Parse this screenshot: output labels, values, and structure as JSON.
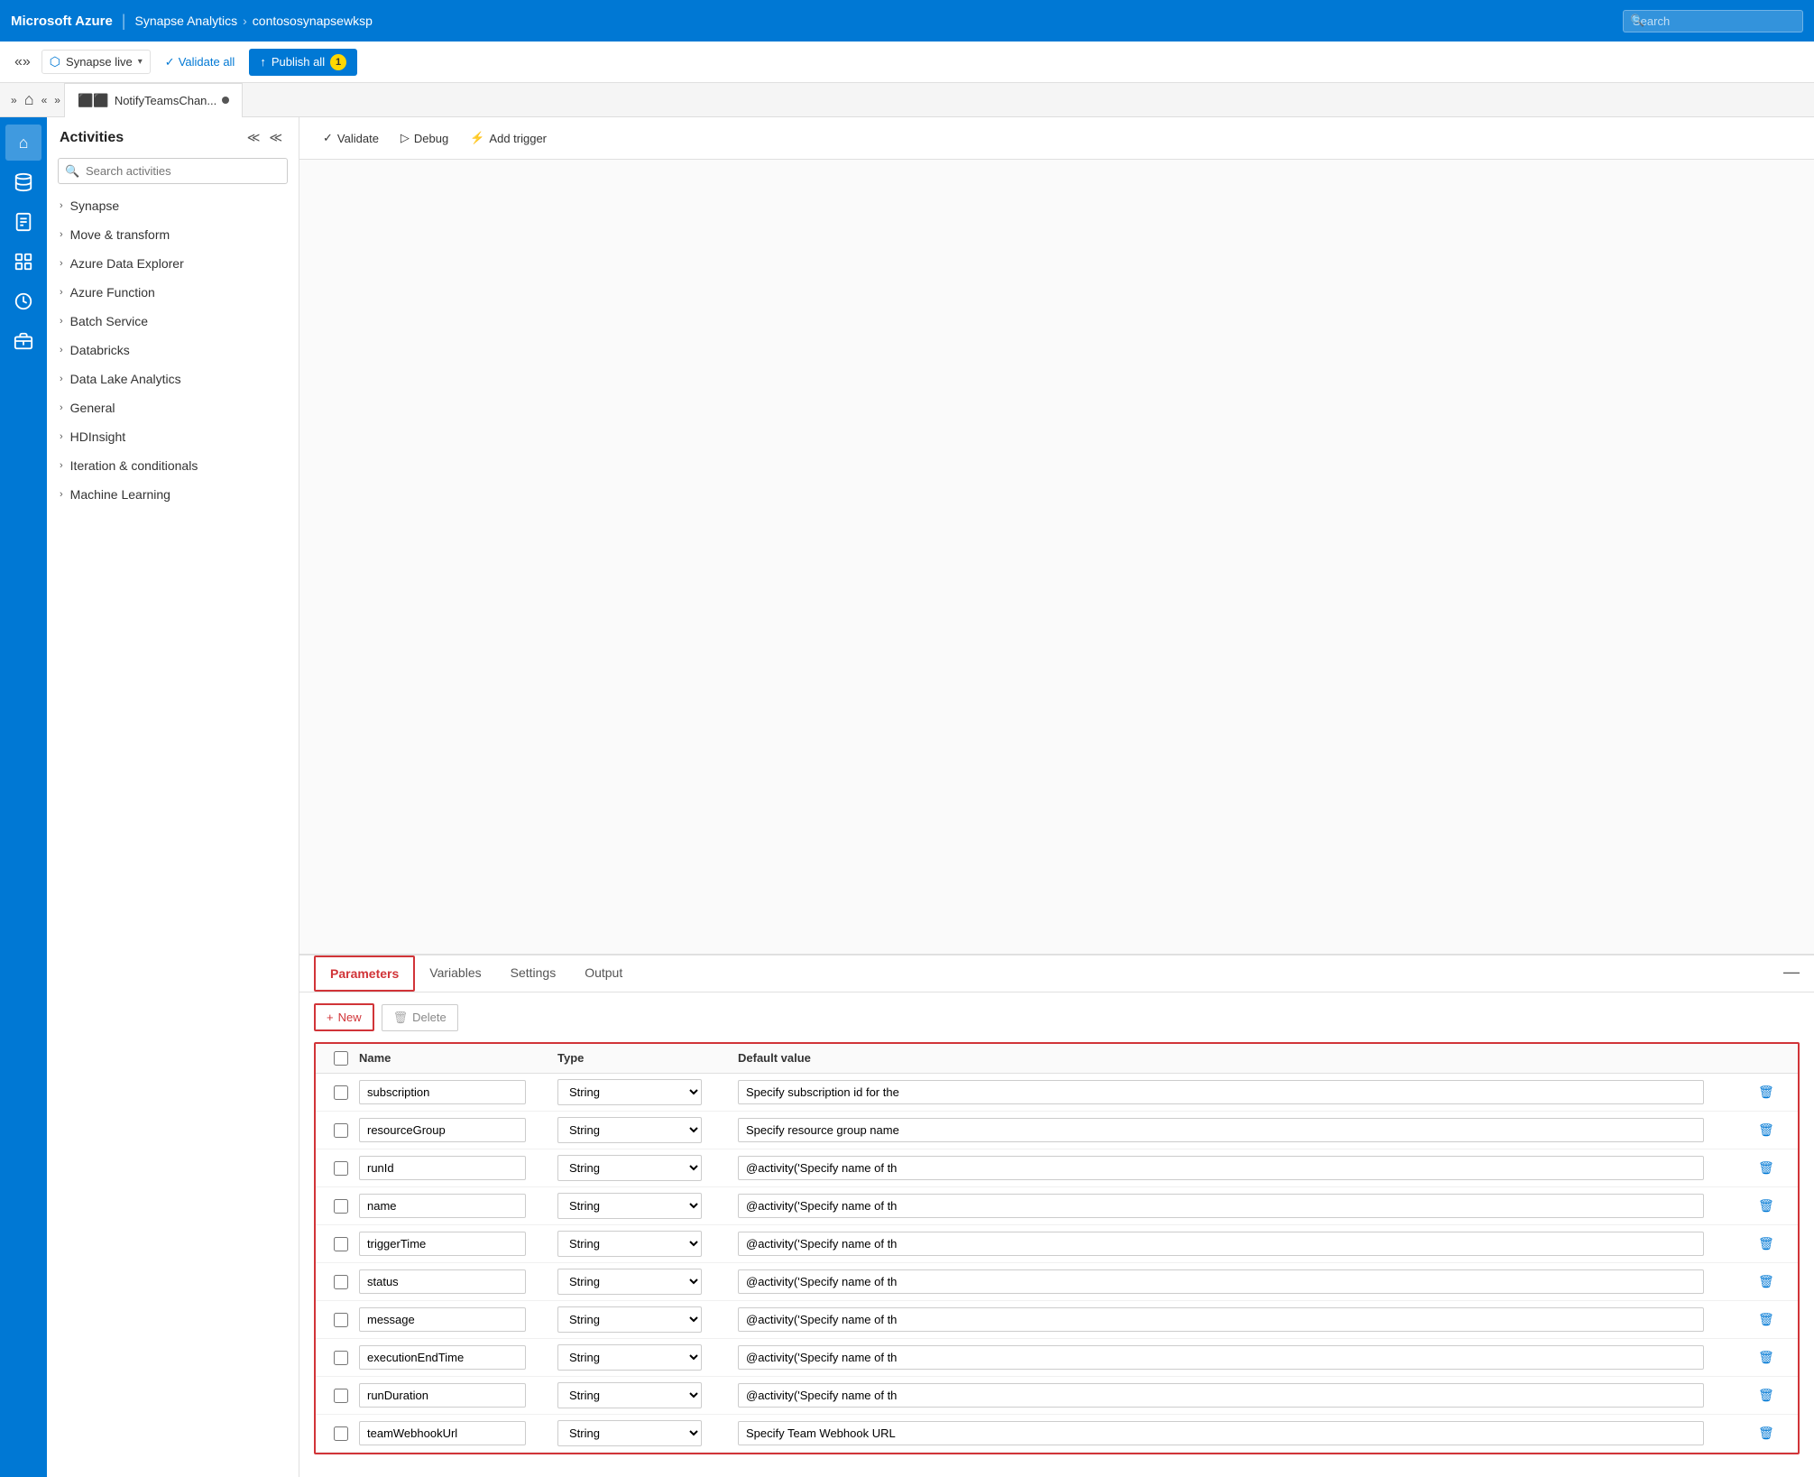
{
  "topNav": {
    "brand": "Microsoft Azure",
    "divider": "|",
    "breadcrumbs": [
      "Synapse Analytics",
      "contososynapsewksp"
    ],
    "searchPlaceholder": "Search"
  },
  "secondaryToolbar": {
    "environment": "Synapse live",
    "validateLabel": "Validate all",
    "publishLabel": "Publish all",
    "publishBadge": "1"
  },
  "tabBar": {
    "tabName": "NotifyTeamsChan...",
    "dotTitle": "unsaved"
  },
  "activities": {
    "title": "Activities",
    "searchPlaceholder": "Search activities",
    "items": [
      {
        "label": "Synapse"
      },
      {
        "label": "Move & transform"
      },
      {
        "label": "Azure Data Explorer"
      },
      {
        "label": "Azure Function"
      },
      {
        "label": "Batch Service"
      },
      {
        "label": "Databricks"
      },
      {
        "label": "Data Lake Analytics"
      },
      {
        "label": "General"
      },
      {
        "label": "HDInsight"
      },
      {
        "label": "Iteration & conditionals"
      },
      {
        "label": "Machine Learning"
      }
    ]
  },
  "canvasToolbar": {
    "validateLabel": "Validate",
    "debugLabel": "Debug",
    "addTriggerLabel": "Add trigger"
  },
  "bottomPanel": {
    "tabs": [
      {
        "label": "Parameters",
        "active": true
      },
      {
        "label": "Variables"
      },
      {
        "label": "Settings"
      },
      {
        "label": "Output"
      }
    ],
    "newLabel": "New",
    "deleteLabel": "Delete",
    "columns": {
      "name": "Name",
      "type": "Type",
      "defaultValue": "Default value"
    },
    "parameters": [
      {
        "name": "subscription",
        "type": "String",
        "defaultValue": "Specify subscription id for the"
      },
      {
        "name": "resourceGroup",
        "type": "String",
        "defaultValue": "Specify resource group name"
      },
      {
        "name": "runId",
        "type": "String",
        "defaultValue": "@activity('Specify name of th"
      },
      {
        "name": "name",
        "type": "String",
        "defaultValue": "@activity('Specify name of th"
      },
      {
        "name": "triggerTime",
        "type": "String",
        "defaultValue": "@activity('Specify name of th"
      },
      {
        "name": "status",
        "type": "String",
        "defaultValue": "@activity('Specify name of th"
      },
      {
        "name": "message",
        "type": "String",
        "defaultValue": "@activity('Specify name of th"
      },
      {
        "name": "executionEndTime",
        "type": "String",
        "defaultValue": "@activity('Specify name of th"
      },
      {
        "name": "runDuration",
        "type": "String",
        "defaultValue": "@activity('Specify name of th"
      },
      {
        "name": "teamWebhookUrl",
        "type": "String",
        "defaultValue": "Specify Team Webhook URL"
      }
    ]
  },
  "icons": {
    "home": "⌂",
    "database": "🗄",
    "document": "📄",
    "layers": "⬛",
    "monitor": "🖥",
    "briefcase": "💼",
    "chevronRight": "›",
    "chevronDown": "⌄",
    "search": "🔍",
    "validate": "✓",
    "debug": "▷",
    "trigger": "⚡",
    "plus": "+",
    "trash": "🗑",
    "upload": "↑",
    "collapse1": "≪",
    "collapse2": "≫",
    "minimize": "—"
  }
}
